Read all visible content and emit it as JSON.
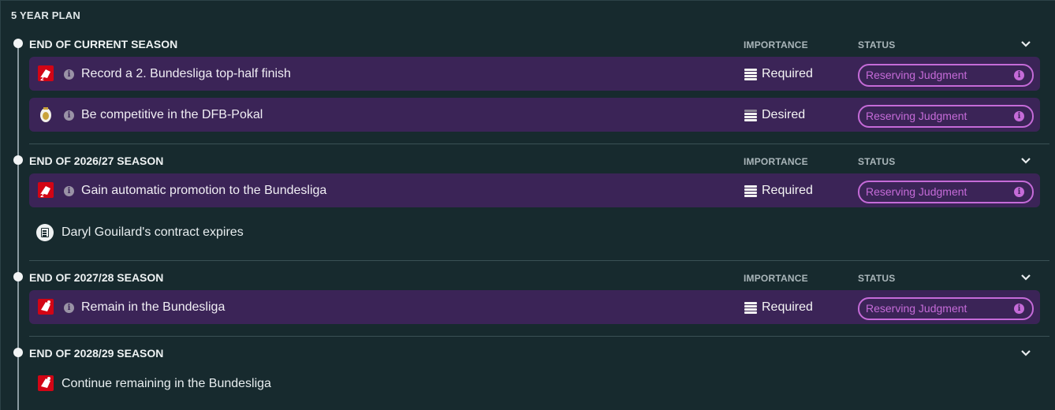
{
  "panel": {
    "title": "5 YEAR PLAN"
  },
  "columns": {
    "importance": "IMPORTANCE",
    "status": "STATUS"
  },
  "sections": [
    {
      "title": "END OF CURRENT SEASON",
      "objectives": [
        {
          "icon": "2-bundesliga-logo-icon",
          "text": "Record a 2. Bundesliga top-half finish",
          "importance": "Required",
          "status": "Reserving Judgment"
        },
        {
          "icon": "dfb-pokal-trophy-icon",
          "text": "Be competitive in the DFB-Pokal",
          "importance": "Desired",
          "status": "Reserving Judgment"
        }
      ]
    },
    {
      "title": "END OF 2026/27 SEASON",
      "objectives": [
        {
          "icon": "2-bundesliga-logo-icon",
          "text": "Gain automatic promotion to the Bundesliga",
          "importance": "Required",
          "status": "Reserving Judgment"
        }
      ],
      "events": [
        {
          "icon": "contract-icon",
          "text": "Daryl Gouilard's contract expires"
        }
      ]
    },
    {
      "title": "END OF 2027/28 SEASON",
      "objectives": [
        {
          "icon": "bundesliga-logo-icon",
          "text": "Remain in the Bundesliga",
          "importance": "Required",
          "status": "Reserving Judgment"
        }
      ]
    },
    {
      "title": "END OF 2028/29 SEASON",
      "events": [
        {
          "icon": "bundesliga-logo-icon",
          "text": "Continue remaining in the Bundesliga"
        }
      ]
    }
  ],
  "colors": {
    "background": "#172a2e",
    "row": "#3b2457",
    "status_accent": "#c56bd8",
    "bundesliga_red": "#d20515"
  }
}
